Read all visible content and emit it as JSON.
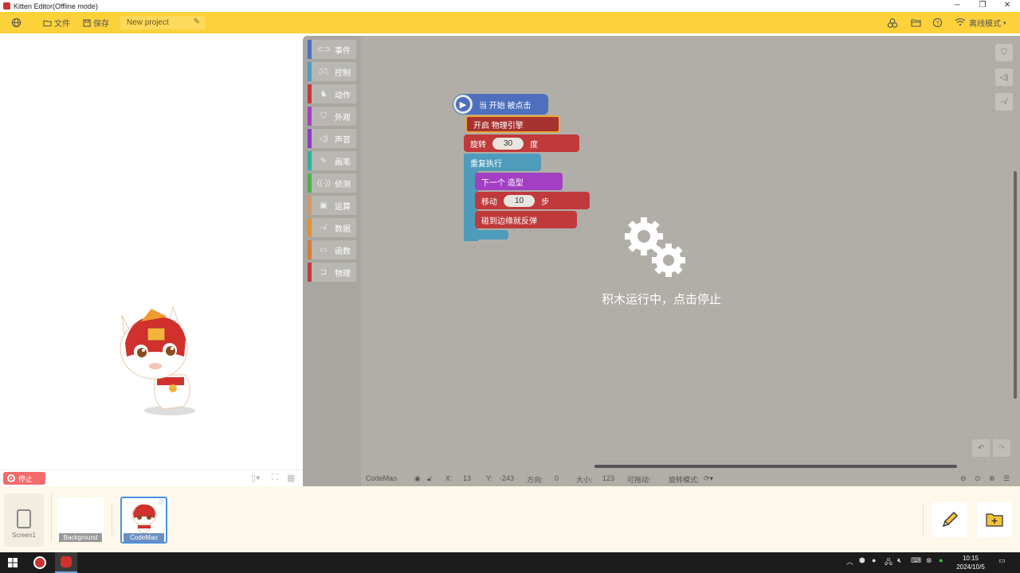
{
  "window": {
    "title": "Kitten Editor(Offline mode)"
  },
  "toolbar": {
    "file_label": "文件",
    "save_label": "保存",
    "project_name": "New project",
    "mode_label": "离线模式"
  },
  "stage_bar": {
    "stop_label": "停止"
  },
  "categories": [
    {
      "label": "事件",
      "color": "#4d6fbd",
      "icon": "toggle-icon"
    },
    {
      "label": "控制",
      "color": "#4f9bbb",
      "icon": "gamepad-icon"
    },
    {
      "label": "动作",
      "color": "#c0393b",
      "icon": "run-icon"
    },
    {
      "label": "外观",
      "color": "#a23fc2",
      "icon": "shirt-icon"
    },
    {
      "label": "声音",
      "color": "#8c3bc2",
      "icon": "speaker-icon"
    },
    {
      "label": "画笔",
      "color": "#2bb09d",
      "icon": "pen-icon"
    },
    {
      "label": "侦测",
      "color": "#4cb050",
      "icon": "radar-icon"
    },
    {
      "label": "运算",
      "color": "#d09a6b",
      "icon": "calculator-icon"
    },
    {
      "label": "数据",
      "color": "#e0913a",
      "icon": "chart-icon"
    },
    {
      "label": "函数",
      "color": "#d67a3a",
      "icon": "function-icon"
    },
    {
      "label": "物理",
      "color": "#c0393b",
      "icon": "physics-icon"
    }
  ],
  "blocks": {
    "hat": "当 开始 被点击",
    "physics": "开启 物理引擎",
    "rotate_label": "旋转",
    "rotate_value": "30",
    "rotate_unit": "度",
    "loop": "重复执行",
    "next_costume": "下一个 造型",
    "move_label": "移动",
    "move_value": "10",
    "move_unit": "步",
    "bounce": "碰到边缘就反弹"
  },
  "overlay": {
    "message": "积木运行中，点击停止"
  },
  "status": {
    "sprite": "CodeMao",
    "x_label": "X:",
    "x_value": "13",
    "y_label": "Y:",
    "y_value": "-243",
    "dir_label": "方向:",
    "dir_value": "0",
    "size_label": "大小:",
    "size_value": "123",
    "drag_label": "可拖动:",
    "rotmode_label": "旋转模式:"
  },
  "assets": {
    "screen_label": "Screen1",
    "background_label": "Background",
    "sprite_label": "CodeMao"
  },
  "taskbar": {
    "time": "10:15",
    "date": "2024/10/5"
  },
  "colors": {
    "toolbar": "#fdd13a",
    "workspace": "#b1aea8",
    "stop": "#f36a6a"
  }
}
